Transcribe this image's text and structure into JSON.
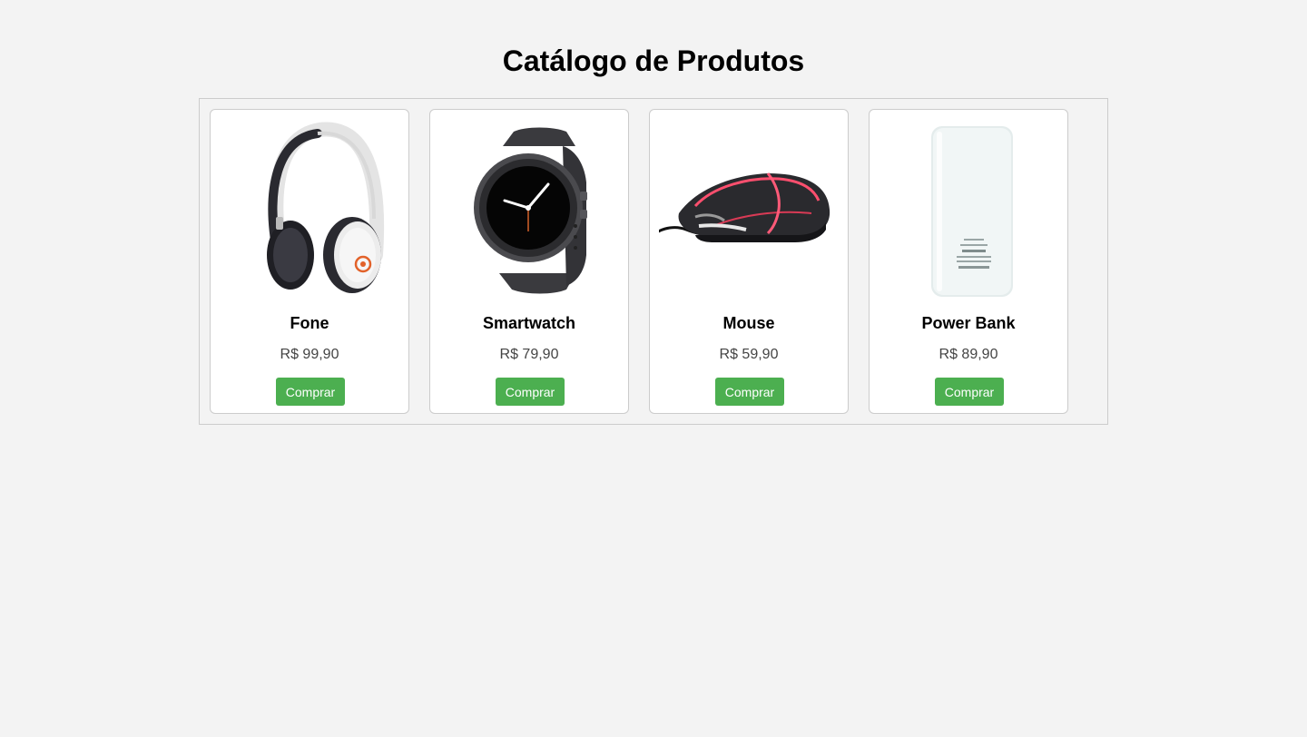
{
  "page": {
    "title": "Catálogo de Produtos"
  },
  "colors": {
    "background": "#f3f3f3",
    "card": "#ffffff",
    "border": "#cccccc",
    "button": "#4caf50",
    "button_text": "#ffffff",
    "price_text": "#444444"
  },
  "products": [
    {
      "name": "Fone",
      "price": "R$ 99,90",
      "button_label": "Comprar",
      "image_icon": "headphones-image"
    },
    {
      "name": "Smartwatch",
      "price": "R$ 79,90",
      "button_label": "Comprar",
      "image_icon": "smartwatch-image"
    },
    {
      "name": "Mouse",
      "price": "R$ 59,90",
      "button_label": "Comprar",
      "image_icon": "gaming-mouse-image"
    },
    {
      "name": "Power Bank",
      "price": "R$ 89,90",
      "button_label": "Comprar",
      "image_icon": "power-bank-image"
    }
  ]
}
